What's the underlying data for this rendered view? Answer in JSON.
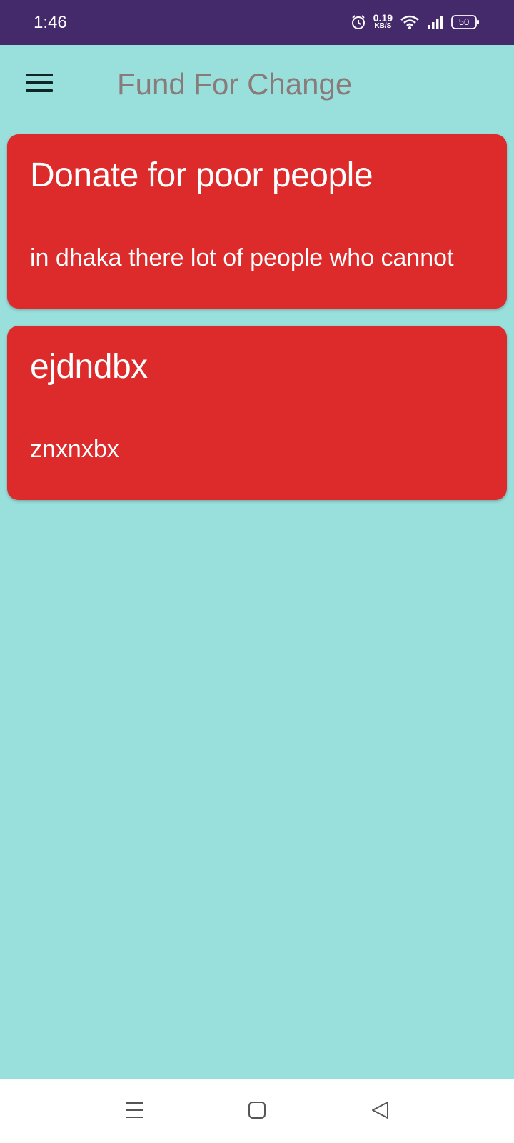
{
  "status_bar": {
    "time": "1:46",
    "net_speed_value": "0.19",
    "net_speed_unit": "KB/S",
    "battery_level": "50",
    "icons": [
      "alarm-icon",
      "wifi-icon",
      "signal-icon",
      "battery-icon"
    ]
  },
  "app_bar": {
    "title": "Fund For Change",
    "menu_icon": "hamburger-menu-icon"
  },
  "cards": [
    {
      "title": "Donate for poor people",
      "description": "in dhaka there lot of people who cannot"
    },
    {
      "title": "ejdndbx",
      "description": "znxnxbx"
    }
  ],
  "nav_bar": {
    "icons": [
      "recents-icon",
      "home-icon",
      "back-icon"
    ]
  },
  "colors": {
    "status_bar": "#44296b",
    "background": "#99e0dc",
    "card": "#dd2a2a",
    "title_text": "#8a7a7a",
    "nav_bar": "#ffffff"
  }
}
